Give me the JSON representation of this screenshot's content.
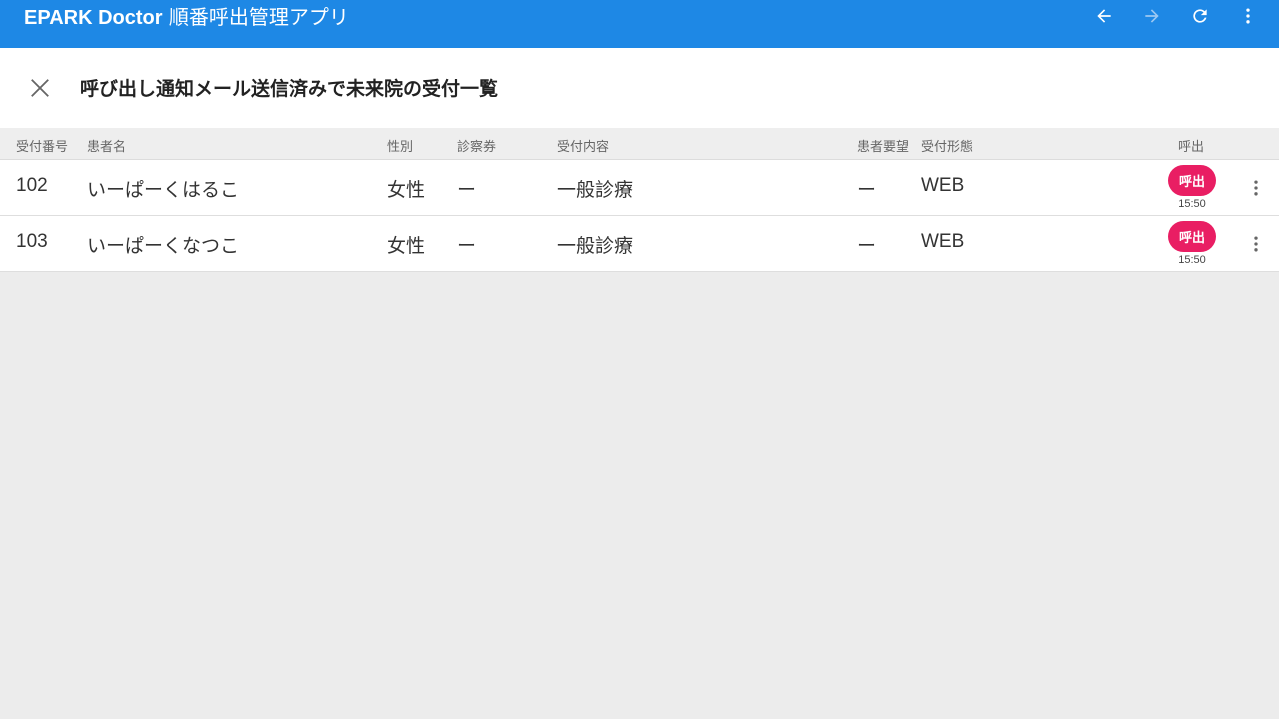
{
  "appbar": {
    "brand": "EPARK Doctor",
    "title_suffix": "順番呼出管理アプリ",
    "color": "#1e88e5",
    "icons": [
      "arrow-left-icon",
      "arrow-right-icon",
      "refresh-icon",
      "more-vert-icon"
    ]
  },
  "dialog": {
    "title": "呼び出し通知メール送信済みで未来院の受付一覧",
    "close_icon": "close-icon"
  },
  "table": {
    "headers": {
      "number": "受付番号",
      "patient": "患者名",
      "sex": "性別",
      "ticket": "診察券",
      "content": "受付内容",
      "request": "患者要望",
      "type": "受付形態",
      "call": "呼出"
    },
    "rows": [
      {
        "number": "102",
        "patient": "いーぱーくはるこ",
        "sex": "女性",
        "ticket": "ー",
        "content": "一般診療",
        "request": "ー",
        "type": "WEB",
        "call_label": "呼出",
        "call_time": "15:50"
      },
      {
        "number": "103",
        "patient": "いーぱーくなつこ",
        "sex": "女性",
        "ticket": "ー",
        "content": "一般診療",
        "request": "ー",
        "type": "WEB",
        "call_label": "呼出",
        "call_time": "15:50"
      }
    ]
  },
  "colors": {
    "accent": "#1e88e5",
    "call_button": "#e91e63",
    "background": "#ececec"
  }
}
